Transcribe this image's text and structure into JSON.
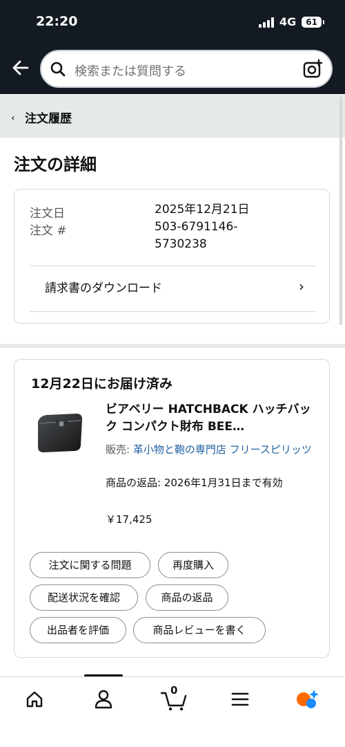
{
  "status": {
    "time": "22:20",
    "network": "4G",
    "battery": "61"
  },
  "search": {
    "placeholder": "検索または質問する"
  },
  "breadcrumb": {
    "label": "注文履歴"
  },
  "page": {
    "title": "注文の詳細"
  },
  "order": {
    "date_label": "注文日",
    "date_value": "2025年12月21日",
    "number_label": "注文 #",
    "number_value_line1": "503-6791146-",
    "number_value_line2": "5730238",
    "invoice_label": "請求書のダウンロード"
  },
  "shipment": {
    "status": "12月22日にお届け済み",
    "product_title": "ビアベリー HATCHBACK ハッチバック コンパクト財布 BEE…",
    "seller_prefix": "販売: ",
    "seller_name": "革小物と鞄の専門店 フリースピリッツ",
    "return_info": "商品の返品: 2026年1月31日まで有効",
    "price": "￥17,425",
    "actions": [
      "注文に関する問題",
      "再度購入",
      "配送状況を確認",
      "商品の返品",
      "出品者を評価",
      "商品レビューを書く"
    ]
  },
  "tabbar": {
    "cart_count": "0",
    "items": [
      "home-icon",
      "account-icon",
      "cart-icon",
      "menu-icon",
      "rufus-icon"
    ]
  },
  "colors": {
    "header_bg": "#131a22",
    "link": "#2162a1",
    "rufus_orange": "#ff6a00",
    "rufus_blue": "#1a8cff"
  }
}
